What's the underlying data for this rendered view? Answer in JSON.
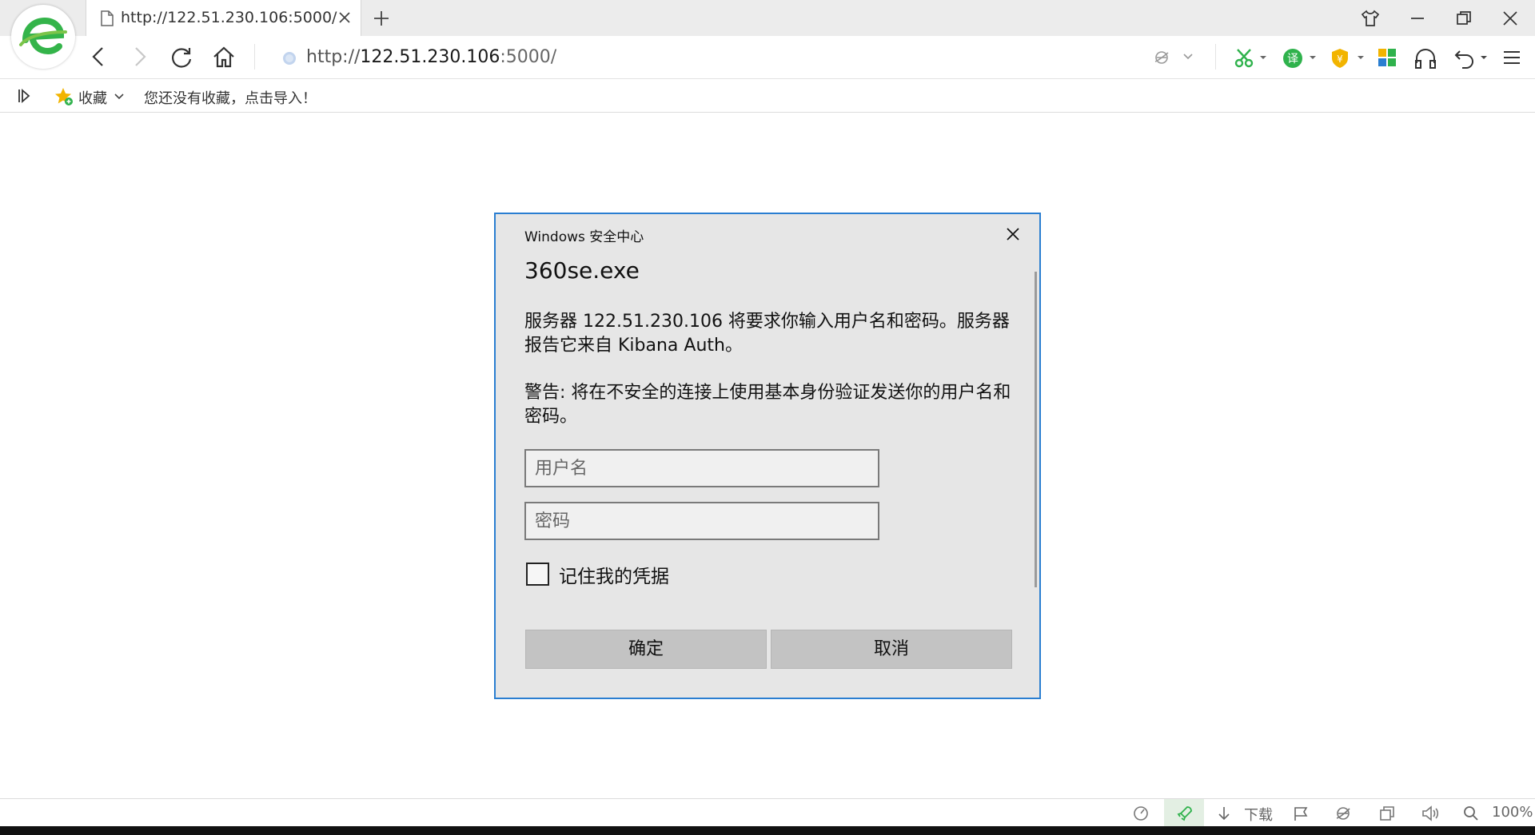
{
  "browser": {
    "tab": {
      "title": "http://122.51.230.106:5000/"
    },
    "address_bar": {
      "url_prefix": "http://",
      "url_host": "122.51.230.106",
      "url_rest": ":5000/"
    },
    "bookmarks_bar": {
      "favorites_label": "收藏",
      "empty_message": "您还没有收藏，点击导入！"
    },
    "status_bar": {
      "download_label": "下载",
      "zoom_label": "100%"
    },
    "colors": {
      "accent_green": "#2fb24c",
      "dialog_border": "#2a7ed1",
      "shield_gold": "#f2b400"
    }
  },
  "dialog": {
    "header": "Windows 安全中心",
    "app_name": "360se.exe",
    "message": "服务器 122.51.230.106 将要求你输入用户名和密码。服务器报告它来自 Kibana Auth。",
    "warning": "警告: 将在不安全的连接上使用基本身份验证发送你的用户名和密码。",
    "username_placeholder": "用户名",
    "password_placeholder": "密码",
    "remember_label": "记住我的凭据",
    "remember_checked": false,
    "ok_label": "确定",
    "cancel_label": "取消"
  },
  "icons": {
    "logo": "browser-e-logo-icon",
    "back": "back-arrow-icon",
    "forward": "forward-arrow-icon",
    "reload": "reload-icon",
    "home": "home-icon"
  }
}
